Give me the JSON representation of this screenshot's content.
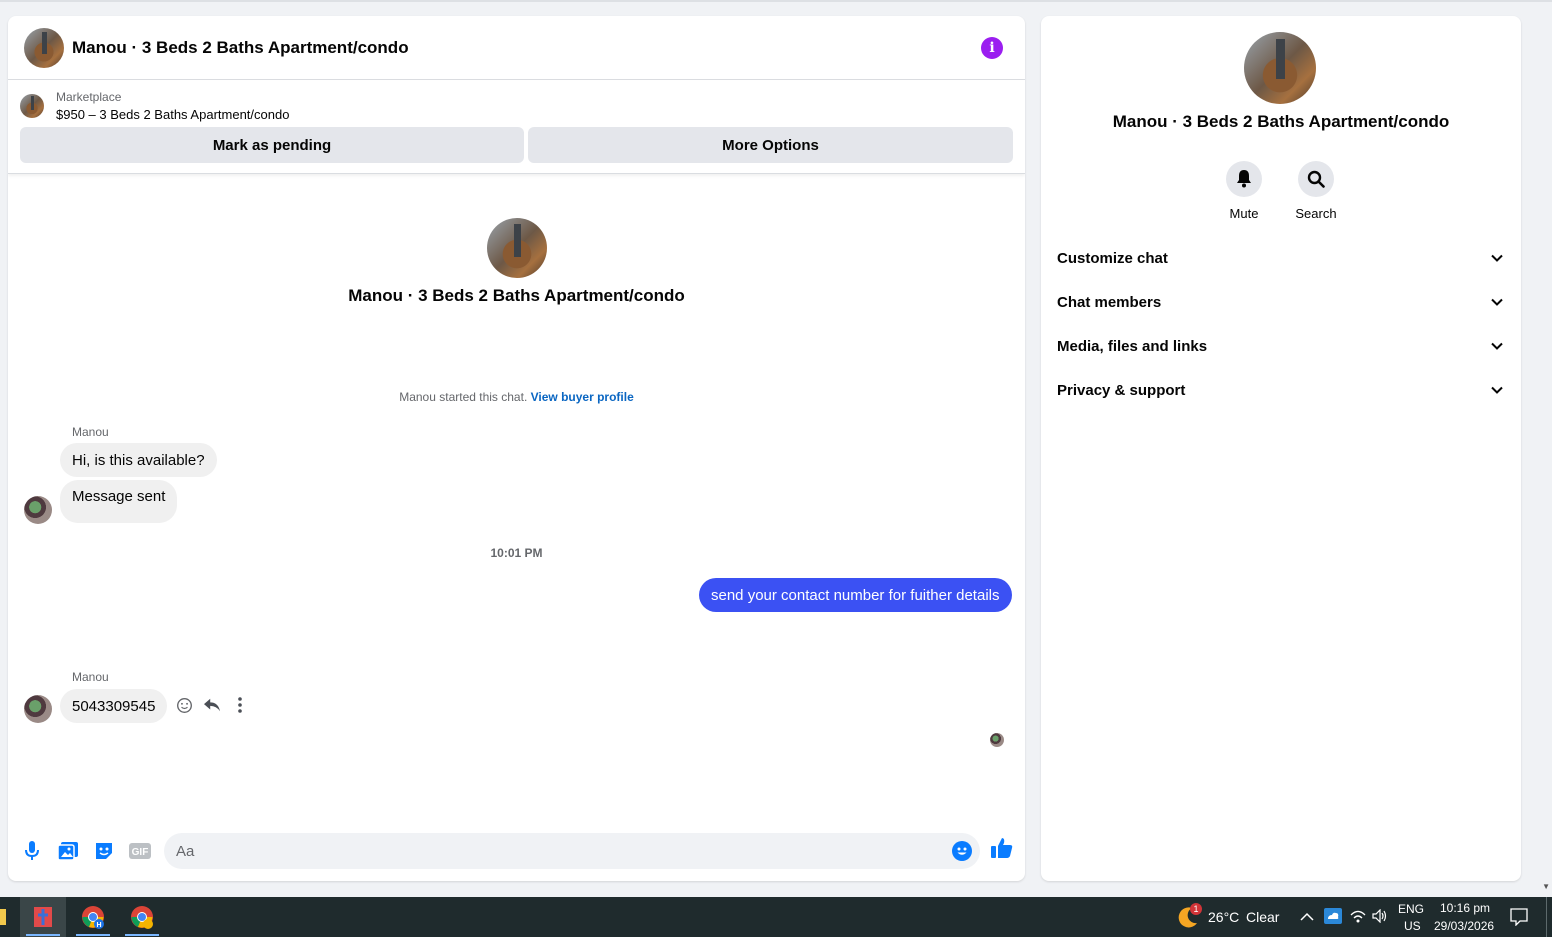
{
  "chat": {
    "title": "Manou · 3 Beds 2 Baths Apartment/condo",
    "marketplace": {
      "label": "Marketplace",
      "listing": "$950 – 3 Beds 2 Baths Apartment/condo",
      "mark_pending_label": "Mark as pending",
      "more_options_label": "More Options"
    },
    "intro_name": "Manou · 3 Beds 2 Baths Apartment/condo",
    "started_text": "Manou started this chat.",
    "view_profile_link": "View buyer profile",
    "messages": [
      {
        "sender": "Manou",
        "text": "Hi, is this available?"
      },
      {
        "text": "Message sent"
      },
      {
        "time": "10:01 PM"
      },
      {
        "outgoing": true,
        "text": "send your contact number for fuither details"
      },
      {
        "sender": "Manou",
        "text": "5043309545"
      }
    ],
    "composer_placeholder": "Aa"
  },
  "side": {
    "name": "Manou · 3 Beds 2 Baths Apartment/condo",
    "mute_label": "Mute",
    "search_label": "Search",
    "menu": [
      "Customize chat",
      "Chat members",
      "Media, files and links",
      "Privacy & support"
    ]
  },
  "taskbar": {
    "weather_badge": "1",
    "temperature": "26°C",
    "condition": "Clear",
    "lang": "ENG",
    "region": "US",
    "time": "10:16 pm",
    "date": "29/03/2026"
  },
  "colors": {
    "accent_purple": "#9b1ef0",
    "outgoing_bubble": "#3b51f3",
    "messenger_blue": "#0a7cff",
    "link_blue": "#0a66c2"
  }
}
